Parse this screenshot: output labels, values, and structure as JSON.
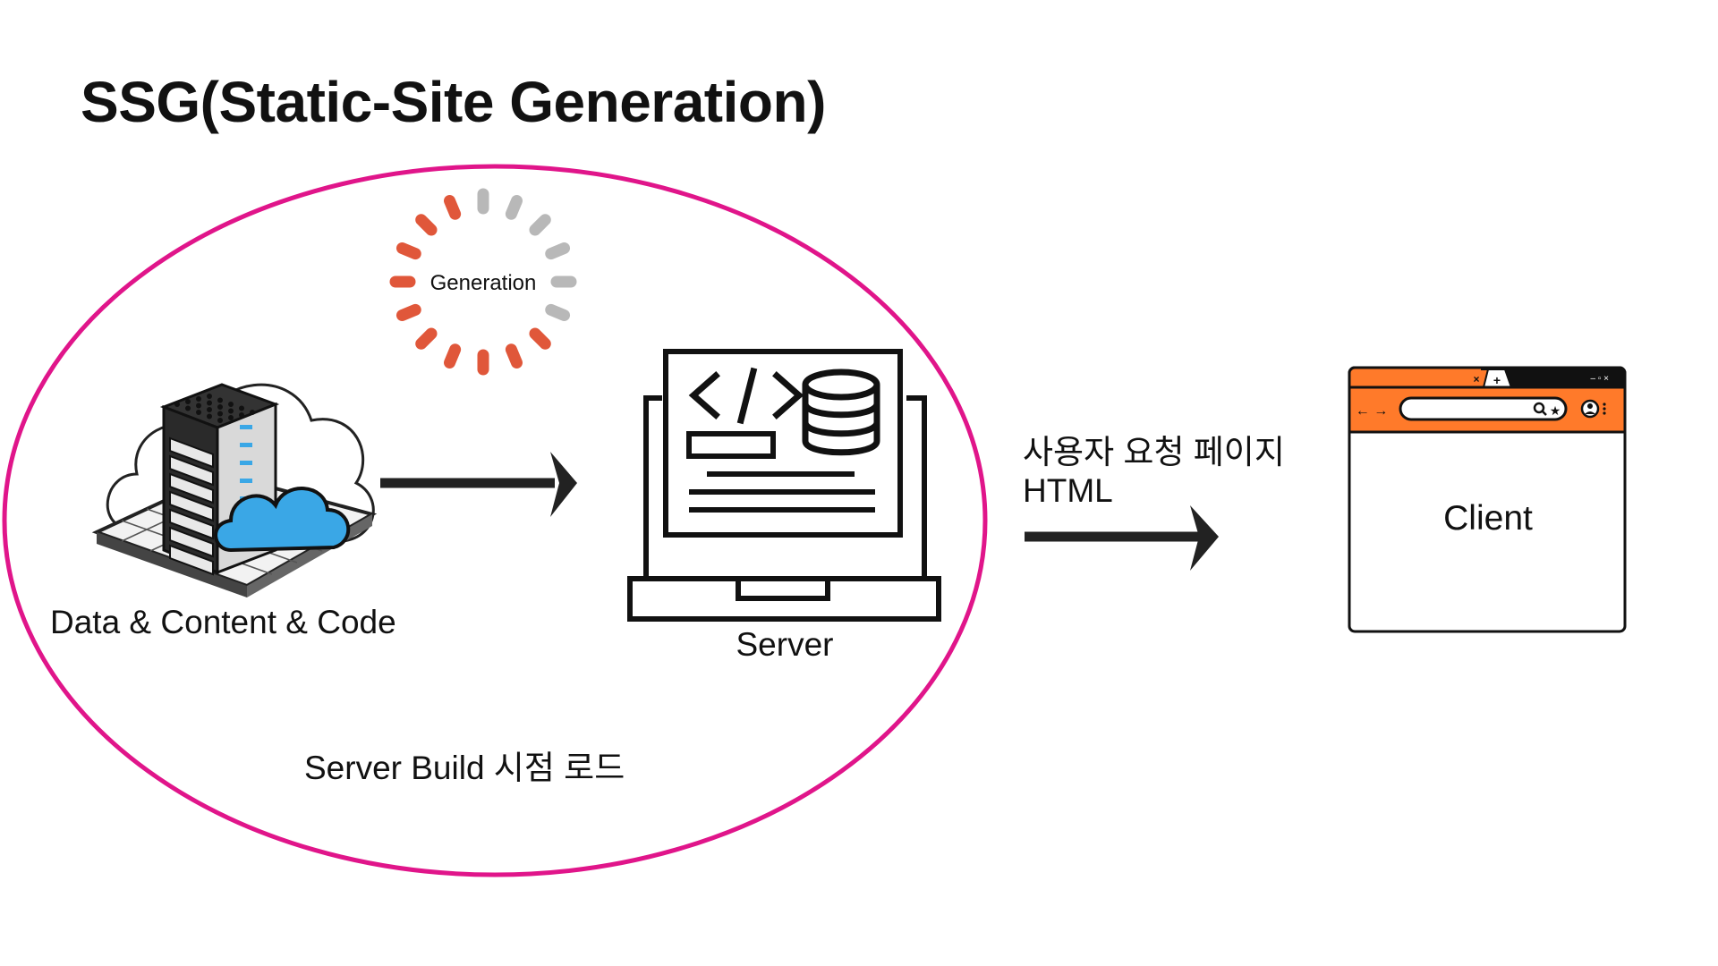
{
  "title": "SSG(Static-Site Generation)",
  "loader": {
    "label": "Generation"
  },
  "data_source": {
    "label": "Data & Content & Code",
    "icon": "server-rack-cloud-icon"
  },
  "server": {
    "label": "Server",
    "icon": "laptop-code-database-icon"
  },
  "build": {
    "label": "Server Build 시점 로드"
  },
  "request": {
    "line1": "사용자 요청 페이지",
    "line2": "HTML"
  },
  "client": {
    "label": "Client",
    "icon": "browser-window-icon"
  },
  "colors": {
    "ellipse": "#e0158a",
    "loader_active": "#e0573a",
    "loader_inactive": "#b8b8b8",
    "browser_chrome": "#ff7a2a",
    "arrow": "#222222",
    "cloud_blue": "#3aa7e6"
  }
}
